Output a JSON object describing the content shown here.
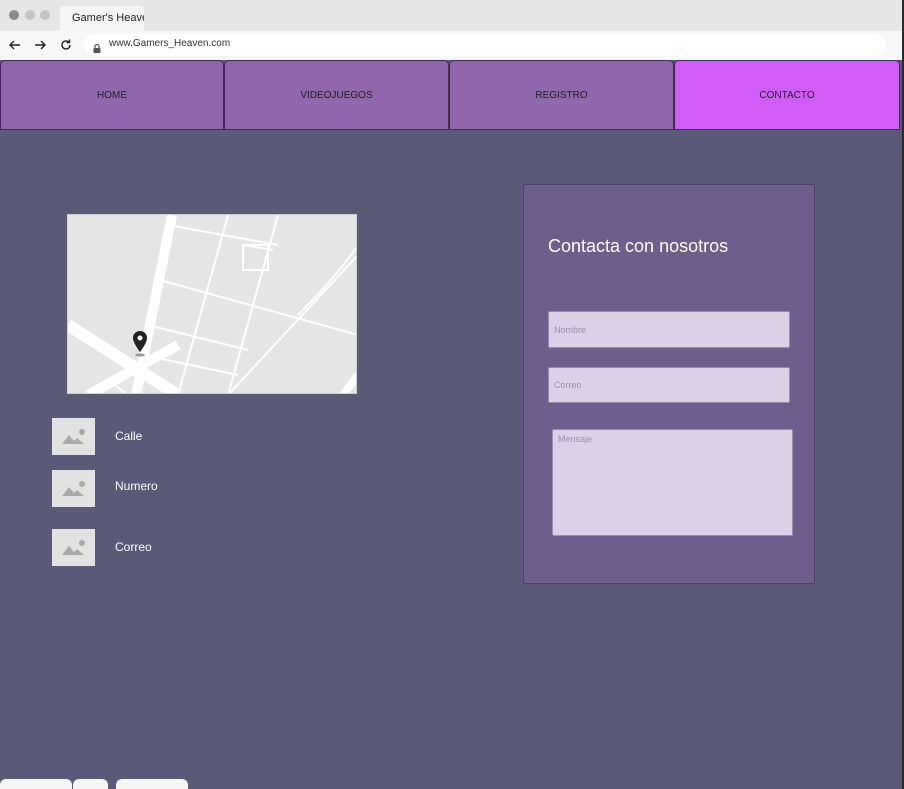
{
  "browser": {
    "tab_title": "Gamer's Heaven",
    "url": "www.Gamers_Heaven.com"
  },
  "nav": {
    "items": [
      {
        "label": "HOME"
      },
      {
        "label": "VIDEOJUEGOS"
      },
      {
        "label": "REGISTRO"
      },
      {
        "label": "CONTACTO"
      }
    ],
    "active": "CONTACTO"
  },
  "contact_info": {
    "items": [
      {
        "label": "Calle",
        "icon": "image-placeholder-icon"
      },
      {
        "label": "Numero",
        "icon": "image-placeholder-icon"
      },
      {
        "label": "Correo",
        "icon": "image-placeholder-icon"
      }
    ]
  },
  "form": {
    "title": "Contacta con nosotros",
    "name_placeholder": "Nombre",
    "email_placeholder": "Correo",
    "message_placeholder": "Mensaje"
  },
  "colors": {
    "background": "#5a5978",
    "nav": "#9066ad",
    "nav_active": "#d25cf6",
    "panel": "#6f5d8b",
    "field": "#ddd0e6"
  }
}
